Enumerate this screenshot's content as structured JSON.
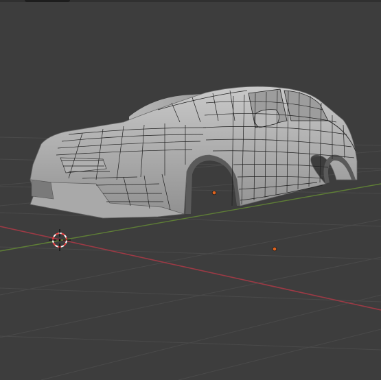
{
  "viewport": {
    "title": "",
    "background_color": "#3d3d3d",
    "grid_color": "#4a4a4a",
    "x_axis_color": "#9c3a45",
    "y_axis_color": "#5f7f36"
  },
  "scene": {
    "object": "car-mesh",
    "mode": "wireframe-overlay",
    "origin_color": "#e0641f"
  },
  "gizmos": {
    "cursor_icon": "3d-cursor-icon",
    "origin_icon": "object-origin-icon"
  }
}
